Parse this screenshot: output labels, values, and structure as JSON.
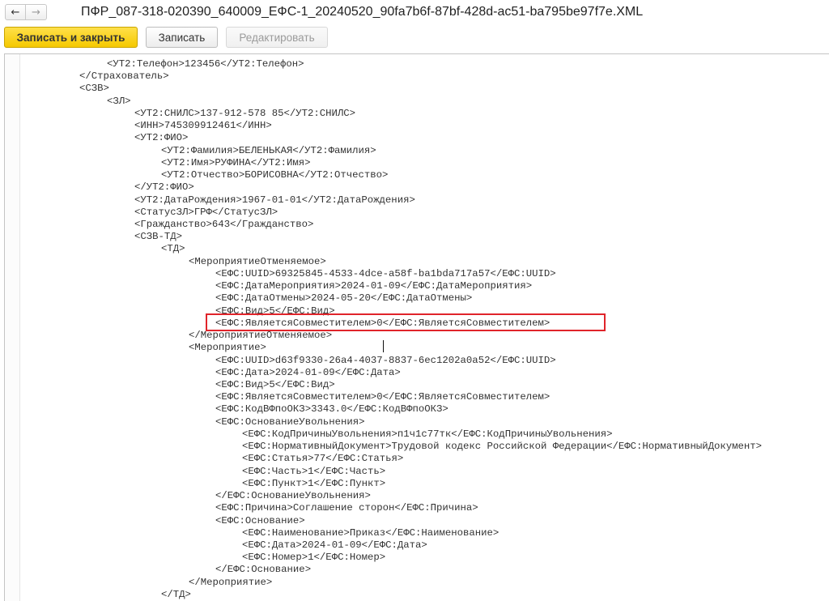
{
  "window": {
    "title": "ПФР_087-318-020390_640009_ЕФС-1_20240520_90fa7b6f-87bf-428d-ac51-ba795be97f7e.XML",
    "nav_back_icon": "arrow-left-icon",
    "nav_forward_icon": "arrow-right-icon"
  },
  "toolbar": {
    "save_close_label": "Записать и закрыть",
    "save_label": "Записать",
    "edit_label": "Редактировать"
  },
  "editor": {
    "lines": [
      "<УТ2:Телефон>123456</УТ2:Телефон>",
      "</Страхователь>",
      "<СЗВ>",
      "<ЗЛ>",
      "<УТ2:СНИЛС>137-912-578 85</УТ2:СНИЛС>",
      "<ИНН>745309912461</ИНН>",
      "<УТ2:ФИО>",
      "<УТ2:Фамилия>БЕЛЕНЬКАЯ</УТ2:Фамилия>",
      "<УТ2:Имя>РУФИНА</УТ2:Имя>",
      "<УТ2:Отчество>БОРИСОВНА</УТ2:Отчество>",
      "</УТ2:ФИО>",
      "<УТ2:ДатаРождения>1967-01-01</УТ2:ДатаРождения>",
      "<СтатусЗЛ>ГРФ</СтатусЗЛ>",
      "<Гражданство>643</Гражданство>",
      "<СЗВ-ТД>",
      "<ТД>",
      "<МероприятиеОтменяемое>",
      "<ЕФС:UUID>69325845-4533-4dce-a58f-ba1bda717a57</ЕФС:UUID>",
      "<ЕФС:ДатаМероприятия>2024-01-09</ЕФС:ДатаМероприятия>",
      "<ЕФС:ДатаОтмены>2024-05-20</ЕФС:ДатаОтмены>",
      "<ЕФС:Вид>5</ЕФС:Вид>",
      "<ЕФС:ЯвляетсяСовместителем>0</ЕФС:ЯвляетсяСовместителем>",
      "</МероприятиеОтменяемое>",
      "<Мероприятие>",
      "<ЕФС:UUID>d63f9330-26a4-4037-8837-6ec1202a0a52</ЕФС:UUID>",
      "<ЕФС:Дата>2024-01-09</ЕФС:Дата>",
      "<ЕФС:Вид>5</ЕФС:Вид>",
      "<ЕФС:ЯвляетсяСовместителем>0</ЕФС:ЯвляетсяСовместителем>",
      "<ЕФС:КодВФпоОКЗ>3343.0</ЕФС:КодВФпоОКЗ>",
      "<ЕФС:ОснованиеУвольнения>",
      "<ЕФС:КодПричиныУвольнения>п1ч1с77тк</ЕФС:КодПричиныУвольнения>",
      "<ЕФС:НормативныйДокумент>Трудовой кодекс Российской Федерации</ЕФС:НормативныйДокумент>",
      "<ЕФС:Статья>77</ЕФС:Статья>",
      "<ЕФС:Часть>1</ЕФС:Часть>",
      "<ЕФС:Пункт>1</ЕФС:Пункт>",
      "</ЕФС:ОснованиеУвольнения>",
      "<ЕФС:Причина>Соглашение сторон</ЕФС:Причина>",
      "<ЕФС:Основание>",
      "<ЕФС:Наименование>Приказ</ЕФС:Наименование>",
      "<ЕФС:Дата>2024-01-09</ЕФС:Дата>",
      "<ЕФС:Номер>1</ЕФС:Номер>",
      "</ЕФС:Основание>",
      "</Мероприятие>",
      "</ТД>"
    ],
    "highlighted_line": "<ЕФС:ЯвляетсяСовместителем>0</ЕФС:ЯвляетсяСовместителем>",
    "highlight_color": "#e0242a"
  }
}
